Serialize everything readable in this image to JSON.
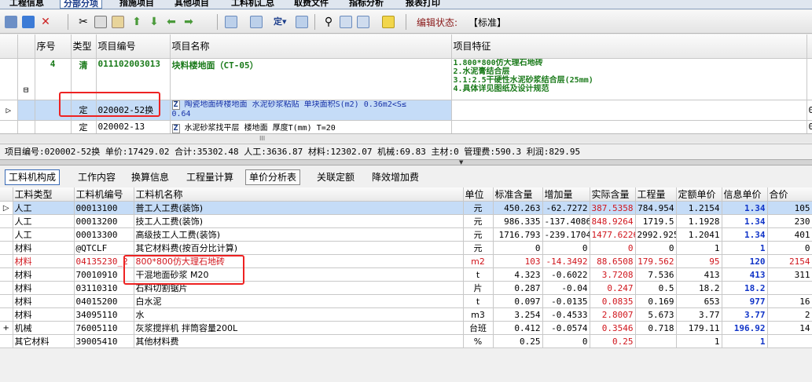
{
  "top_tabs": [
    "工程信息",
    "分部分项",
    "措施项目",
    "其他项目",
    "工料机汇总",
    "取费文件",
    "指标分析",
    "报表打印"
  ],
  "toolbar": {
    "status_label": "编辑状态:",
    "status_value": "【标准】"
  },
  "upper_grid": {
    "headers": [
      "序号",
      "类型",
      "项目编号",
      "项目名称",
      "项目特征"
    ],
    "item_row": {
      "seq": "4",
      "type": "清",
      "code": "011102003013",
      "name": "块料楼地面（CT-05）",
      "features": [
        "1.800*800仿大理石地砖",
        "2.水泥膏结合层",
        "3.1:2.5干硬性水泥砂浆结合层(25mm)",
        "4.具体详见图纸及设计规范"
      ],
      "tree_toggle": "⊟"
    },
    "sub_rows": [
      {
        "type": "定",
        "code": "020002-52换",
        "name_line1": "陶瓷地面砖楼地面 水泥砂浆粘贴 单块面积S(m2) 0.36m2<S≤",
        "name_line2": "0.64",
        "badge": "Z"
      },
      {
        "type": "定",
        "code": "020002-13",
        "name_line1": "水泥砂浆找平层 楼地面 厚度T(mm) T=20",
        "badge": "Z"
      }
    ],
    "right_edge_marks": [
      "0",
      "0"
    ]
  },
  "info_bar": "项目编号:020002-52换  单价:17429.02  合计:35302.48  人工:3636.87  材料:12302.07  机械:69.83  主材:0  管理费:590.3  利润:829.95",
  "lower_tabs": [
    "工料机构成",
    "工作内容",
    "换算信息",
    "工程量计算",
    "单价分析表",
    "关联定额",
    "降效增加费"
  ],
  "lower_grid": {
    "headers": [
      "工料类型",
      "工料机编号",
      "工料机名称",
      "单位",
      "标准含量",
      "增加量",
      "实际含量",
      "工程量",
      "定额单价",
      "信息单价",
      "合价"
    ],
    "rows": [
      {
        "type": "人工",
        "code": "00013100",
        "name": "普工人工费(装饰)",
        "unit": "元",
        "std": "450.263",
        "add": "-62.7272",
        "actual": "387.5358",
        "qty": "784.954",
        "price": "1.2154",
        "info": "1.34",
        "total": "105"
      },
      {
        "type": "人工",
        "code": "00013200",
        "name": "技工人工费(装饰)",
        "unit": "元",
        "std": "986.335",
        "add": "-137.4086",
        "actual": "848.9264",
        "qty": "1719.5",
        "price": "1.1928",
        "info": "1.34",
        "total": "230"
      },
      {
        "type": "人工",
        "code": "00013300",
        "name": "高级技工人工费(装饰)",
        "unit": "元",
        "std": "1716.793",
        "add": "-239.1704",
        "actual": "1477.6226",
        "qty": "2992.925",
        "price": "1.2041",
        "info": "1.34",
        "total": "401"
      },
      {
        "type": "材料",
        "code": "@QTCLF",
        "name": "其它材料费(按百分比计算)",
        "unit": "元",
        "std": "0",
        "add": "0",
        "actual": "0",
        "qty": "0",
        "price": "1",
        "info": "1",
        "total": "0"
      },
      {
        "type": "材料",
        "code": "04135230_2",
        "name": "800*800仿大理石地砖",
        "unit": "m2",
        "std": "103",
        "add": "-14.3492",
        "actual": "88.6508",
        "qty": "179.562",
        "price": "95",
        "info": "120",
        "total": "2154"
      },
      {
        "type": "材料",
        "code": "70010910",
        "name": "干混地面砂浆 M20",
        "unit": "t",
        "std": "4.323",
        "add": "-0.6022",
        "actual": "3.7208",
        "qty": "7.536",
        "price": "413",
        "info": "413",
        "total": "311"
      },
      {
        "type": "材料",
        "code": "03110310",
        "name": "石料切割锯片",
        "unit": "片",
        "std": "0.287",
        "add": "-0.04",
        "actual": "0.247",
        "qty": "0.5",
        "price": "18.2",
        "info": "18.2",
        "total": ""
      },
      {
        "type": "材料",
        "code": "04015200",
        "name": "白水泥",
        "unit": "t",
        "std": "0.097",
        "add": "-0.0135",
        "actual": "0.0835",
        "qty": "0.169",
        "price": "653",
        "info": "977",
        "total": "16"
      },
      {
        "type": "材料",
        "code": "34095110",
        "name": "水",
        "unit": "m3",
        "std": "3.254",
        "add": "-0.4533",
        "actual": "2.8007",
        "qty": "5.673",
        "price": "3.77",
        "info": "3.77",
        "total": "2"
      },
      {
        "type": "机械",
        "code": "76005110",
        "name": "灰浆搅拌机 拌筒容量200L",
        "unit": "台班",
        "std": "0.412",
        "add": "-0.0574",
        "actual": "0.3546",
        "qty": "0.718",
        "price": "179.11",
        "info": "196.92",
        "total": "14"
      },
      {
        "type": "其它材料",
        "code": "39005410",
        "name": "其他材料费",
        "unit": "%",
        "std": "0.25",
        "add": "0",
        "actual": "0.25",
        "qty": "",
        "price": "1",
        "info": "1",
        "total": ""
      }
    ]
  },
  "colors": {
    "accent": "#3a6ab5",
    "red": "#d0161d",
    "blue": "#1034c8",
    "selection": "#c5dcf7",
    "green": "#1a7a1a"
  }
}
